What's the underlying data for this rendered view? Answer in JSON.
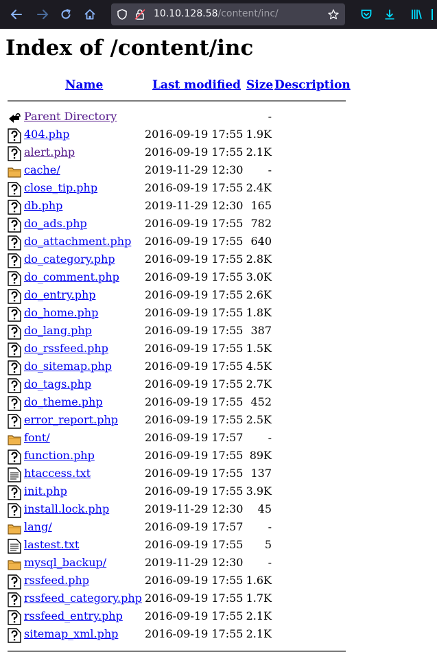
{
  "browser": {
    "url_host": "10.10.128.58",
    "url_path": "/content/inc/"
  },
  "page": {
    "title": "Index of /content/inc",
    "columns": {
      "name": "Name",
      "last_modified": "Last modified",
      "size": "Size",
      "description": "Description"
    },
    "entries": [
      {
        "name": "Parent Directory",
        "date": "",
        "size": "-",
        "icon": "back-icon",
        "visited": true
      },
      {
        "name": "404.php",
        "date": "2016-09-19 17:55",
        "size": "1.9K",
        "icon": "unknown-file-icon"
      },
      {
        "name": "alert.php",
        "date": "2016-09-19 17:55",
        "size": "2.1K",
        "icon": "unknown-file-icon",
        "visited": true
      },
      {
        "name": "cache/",
        "date": "2019-11-29 12:30",
        "size": "-",
        "icon": "folder-icon"
      },
      {
        "name": "close_tip.php",
        "date": "2016-09-19 17:55",
        "size": "2.4K",
        "icon": "unknown-file-icon"
      },
      {
        "name": "db.php",
        "date": "2019-11-29 12:30",
        "size": "165",
        "icon": "unknown-file-icon"
      },
      {
        "name": "do_ads.php",
        "date": "2016-09-19 17:55",
        "size": "782",
        "icon": "unknown-file-icon"
      },
      {
        "name": "do_attachment.php",
        "date": "2016-09-19 17:55",
        "size": "640",
        "icon": "unknown-file-icon"
      },
      {
        "name": "do_category.php",
        "date": "2016-09-19 17:55",
        "size": "2.8K",
        "icon": "unknown-file-icon"
      },
      {
        "name": "do_comment.php",
        "date": "2016-09-19 17:55",
        "size": "3.0K",
        "icon": "unknown-file-icon"
      },
      {
        "name": "do_entry.php",
        "date": "2016-09-19 17:55",
        "size": "2.6K",
        "icon": "unknown-file-icon"
      },
      {
        "name": "do_home.php",
        "date": "2016-09-19 17:55",
        "size": "1.8K",
        "icon": "unknown-file-icon"
      },
      {
        "name": "do_lang.php",
        "date": "2016-09-19 17:55",
        "size": "387",
        "icon": "unknown-file-icon"
      },
      {
        "name": "do_rssfeed.php",
        "date": "2016-09-19 17:55",
        "size": "1.5K",
        "icon": "unknown-file-icon"
      },
      {
        "name": "do_sitemap.php",
        "date": "2016-09-19 17:55",
        "size": "4.5K",
        "icon": "unknown-file-icon"
      },
      {
        "name": "do_tags.php",
        "date": "2016-09-19 17:55",
        "size": "2.7K",
        "icon": "unknown-file-icon"
      },
      {
        "name": "do_theme.php",
        "date": "2016-09-19 17:55",
        "size": "452",
        "icon": "unknown-file-icon"
      },
      {
        "name": "error_report.php",
        "date": "2016-09-19 17:55",
        "size": "2.5K",
        "icon": "unknown-file-icon"
      },
      {
        "name": "font/",
        "date": "2016-09-19 17:57",
        "size": "-",
        "icon": "folder-icon"
      },
      {
        "name": "function.php",
        "date": "2016-09-19 17:55",
        "size": "89K",
        "icon": "unknown-file-icon"
      },
      {
        "name": "htaccess.txt",
        "date": "2016-09-19 17:55",
        "size": "137",
        "icon": "text-file-icon"
      },
      {
        "name": "init.php",
        "date": "2016-09-19 17:55",
        "size": "3.9K",
        "icon": "unknown-file-icon"
      },
      {
        "name": "install.lock.php",
        "date": "2019-11-29 12:30",
        "size": "45",
        "icon": "unknown-file-icon"
      },
      {
        "name": "lang/",
        "date": "2016-09-19 17:57",
        "size": "-",
        "icon": "folder-icon"
      },
      {
        "name": "lastest.txt",
        "date": "2016-09-19 17:55",
        "size": "5",
        "icon": "text-file-icon"
      },
      {
        "name": "mysql_backup/",
        "date": "2019-11-29 12:30",
        "size": "-",
        "icon": "folder-icon"
      },
      {
        "name": "rssfeed.php",
        "date": "2016-09-19 17:55",
        "size": "1.6K",
        "icon": "unknown-file-icon"
      },
      {
        "name": "rssfeed_category.php",
        "date": "2016-09-19 17:55",
        "size": "1.7K",
        "icon": "unknown-file-icon"
      },
      {
        "name": "rssfeed_entry.php",
        "date": "2016-09-19 17:55",
        "size": "2.1K",
        "icon": "unknown-file-icon"
      },
      {
        "name": "sitemap_xml.php",
        "date": "2016-09-19 17:55",
        "size": "2.1K",
        "icon": "unknown-file-icon"
      }
    ]
  },
  "colors": {
    "toolbar_bg": "#1c1b22",
    "urlbar_bg": "#42414d",
    "accent": "#00ddff",
    "link": "#0000ee",
    "visited": "#551a8b"
  }
}
